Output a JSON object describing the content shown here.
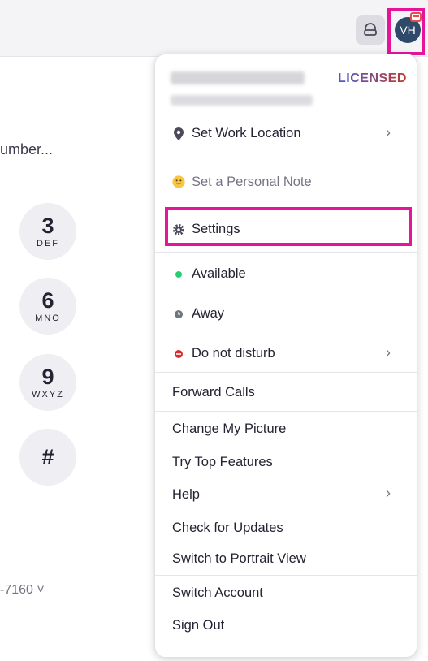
{
  "topbar": {
    "icon_button": "headset-icon",
    "avatar_initials": "VH"
  },
  "dialer": {
    "placeholder": "umber...",
    "keys": [
      {
        "digit": "3",
        "letters": "DEF"
      },
      {
        "digit": "6",
        "letters": "MNO"
      },
      {
        "digit": "9",
        "letters": "WXYZ"
      },
      {
        "digit": "#",
        "letters": ""
      }
    ],
    "caller_id": "-7160 ˅"
  },
  "menu": {
    "licensed": "LICENSED",
    "set_work_location": "Set Work Location",
    "personal_note": "Set a Personal Note",
    "settings": "Settings",
    "available": "Available",
    "away": "Away",
    "do_not_disturb": "Do not disturb",
    "forward_calls": "Forward Calls",
    "change_picture": "Change My Picture",
    "try_top_features": "Try Top Features",
    "help": "Help",
    "check_updates": "Check for Updates",
    "portrait_view": "Switch to Portrait View",
    "switch_account": "Switch Account",
    "sign_out": "Sign Out",
    "chevron": "›"
  },
  "colors": {
    "highlight": "#e6149a",
    "available": "#2ecc71",
    "away": "#6e7680",
    "dnd": "#e02828",
    "avatar_bg": "#2f4a68"
  }
}
